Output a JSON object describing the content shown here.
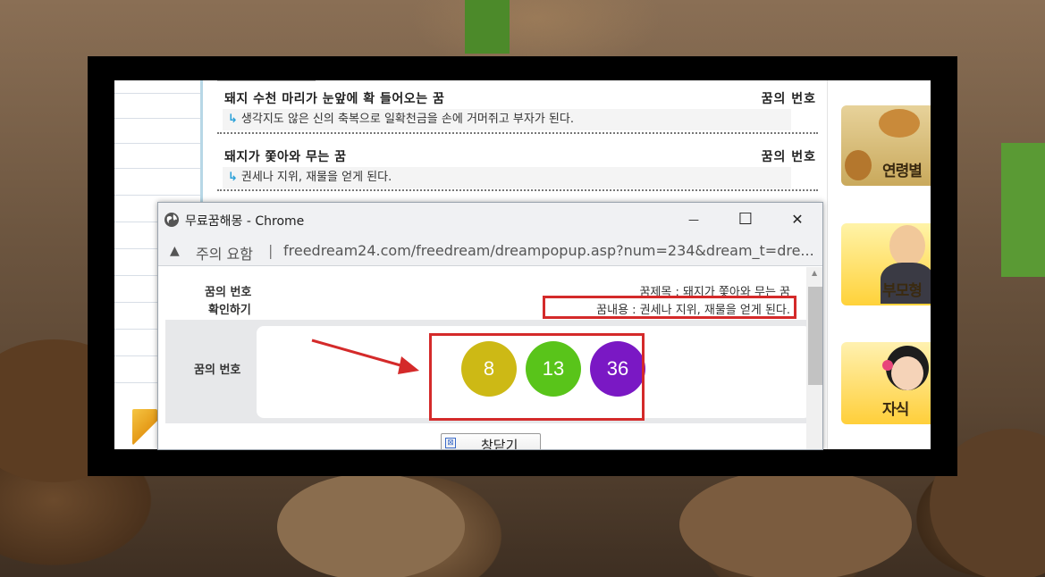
{
  "list": {
    "items": [
      {
        "title": "돼지 수천 마리가 눈앞에 확 들어오는 꿈",
        "link": "꿈의 번호",
        "desc": "생각지도 않은 신의 축복으로 일확천금을 손에 거머쥐고 부자가 된다."
      },
      {
        "title": "돼지가 쫓아와 무는 꿈",
        "link": "꿈의 번호",
        "desc": "권세나 지위, 재물을 얻게 된다."
      }
    ],
    "desc_arrow": "↳"
  },
  "banners": [
    {
      "label": "연령별"
    },
    {
      "label": "부모형"
    },
    {
      "label": "자식"
    }
  ],
  "popup": {
    "window_title": "무료꿈해몽 - Chrome",
    "minimize": "—",
    "maximize": "☐",
    "close": "✕",
    "warning_icon": "▲",
    "warning_text": "주의 요함",
    "separator": "|",
    "url": "freedream24.com/freedream/dreampopup.asp?num=234&dream_t=dre...",
    "label_line1": "꿈의 번호",
    "label_line2": "확인하기",
    "dream_title": "꿈제목 : 돼지가 쫓아와 무는 꿈",
    "dream_content": "꿈내용 : 권세나 지위, 재물을 얻게 된다.",
    "number_label": "꿈의 번호",
    "numbers": [
      {
        "value": "8",
        "color": "#cdb915"
      },
      {
        "value": "13",
        "color": "#59c41a"
      },
      {
        "value": "36",
        "color": "#7a18c4"
      }
    ],
    "close_button": "창닫기",
    "close_button_icon": "⊠"
  },
  "colors": {
    "highlight_red": "#d42a2a",
    "link_arrow": "#2aa0d8"
  }
}
